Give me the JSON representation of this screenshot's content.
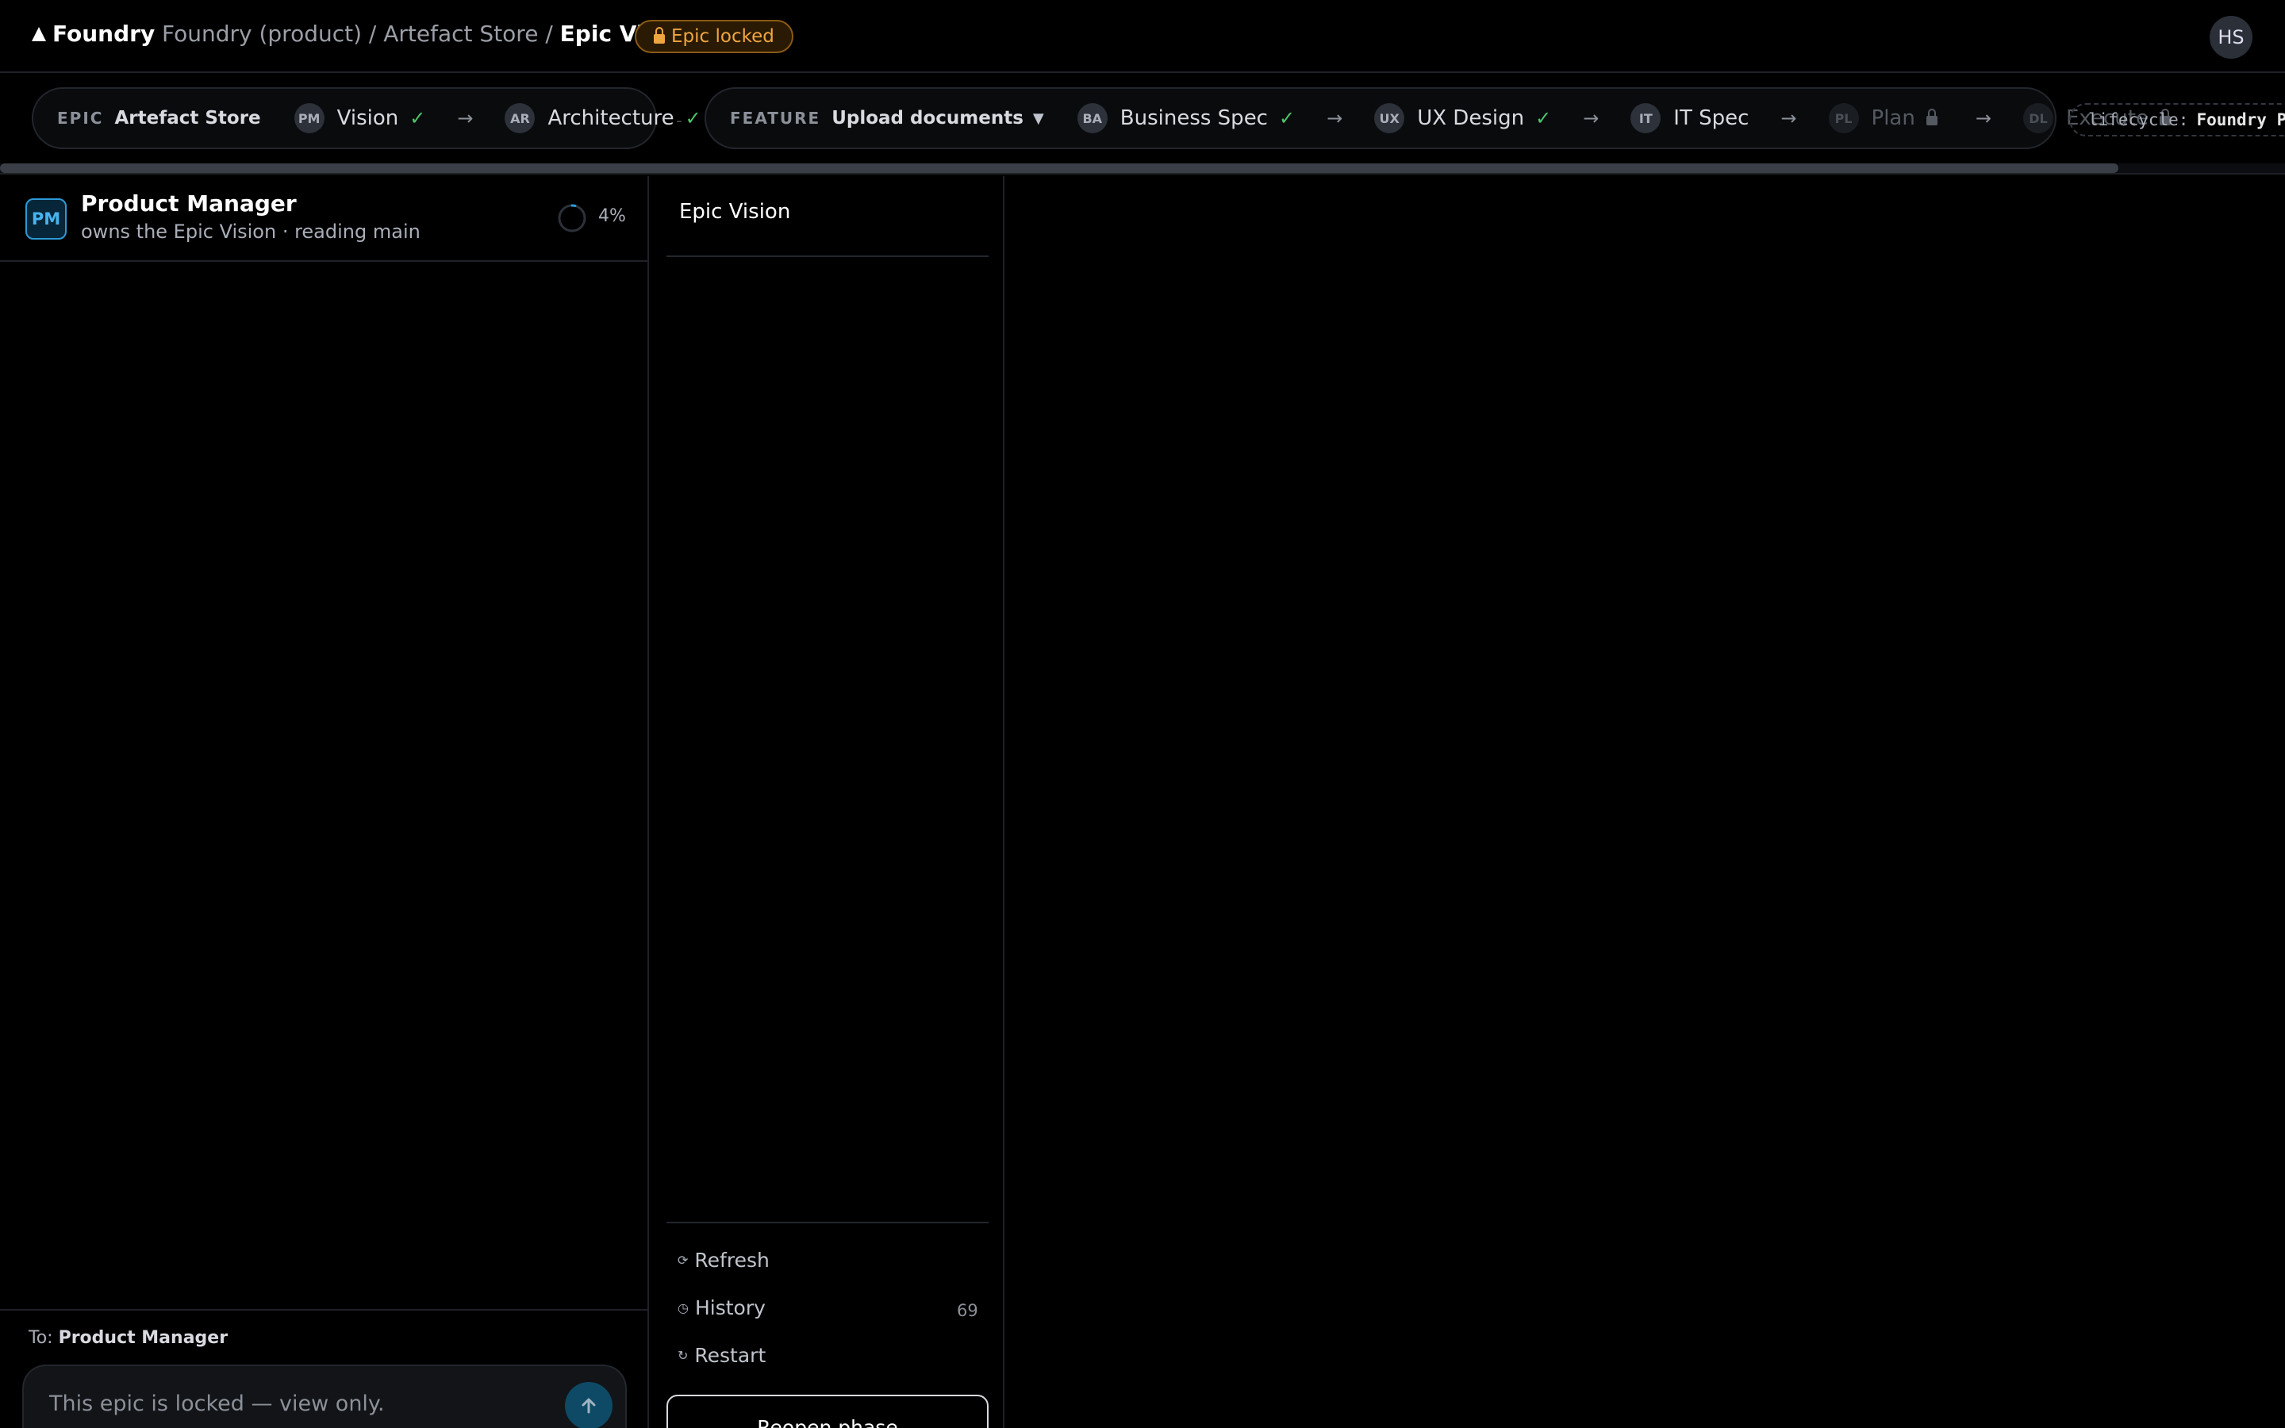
{
  "header": {
    "logo": "Foundry",
    "breadcrumb": {
      "path": "Foundry (product) / Artefact Store / ",
      "current": "Epic Vision"
    },
    "status_badge": "Epic locked",
    "user_initials": "HS"
  },
  "lifecycle_strip": {
    "epic": {
      "kind": "EPIC",
      "name": "Artefact Store",
      "steps": [
        {
          "badge": "PM",
          "label": "Vision",
          "done": "✓"
        },
        {
          "badge": "AR",
          "label": "Architecture",
          "done": "✓"
        }
      ]
    },
    "separator": "-",
    "feature": {
      "kind": "FEATURE",
      "name": "Upload documents",
      "caret": "▼",
      "steps": [
        {
          "badge": "BA",
          "label": "Business Spec",
          "done": "✓"
        },
        {
          "badge": "UX",
          "label": "UX Design",
          "done": "✓"
        },
        {
          "badge": "IT",
          "label": "IT Spec"
        },
        {
          "badge": "PL",
          "label": "Plan",
          "locked": true
        },
        {
          "badge": "DL",
          "label": "Execute",
          "locked": true
        }
      ]
    },
    "arrow": "→",
    "lifecycle_label": "lifecycle:",
    "lifecycle_value": "Foundry PD"
  },
  "agent": {
    "initials": "PM",
    "name": "Product Manager",
    "subtitle": "owns the Epic Vision · reading main",
    "progress": 0.04,
    "progress_label": "4%"
  },
  "composer": {
    "to_label": "To:",
    "to_name": "Product Manager",
    "placeholder": "This epic is locked — view only."
  },
  "doc_panel": {
    "title": "Epic Vision",
    "actions": {
      "refresh": "Refresh",
      "history": "History",
      "history_count": "69",
      "restart": "Restart"
    },
    "reopen_button": "Reopen phase"
  },
  "colors": {
    "accent": "#2b9ad8",
    "locked": "#f0a640",
    "done": "#4fc36a"
  }
}
